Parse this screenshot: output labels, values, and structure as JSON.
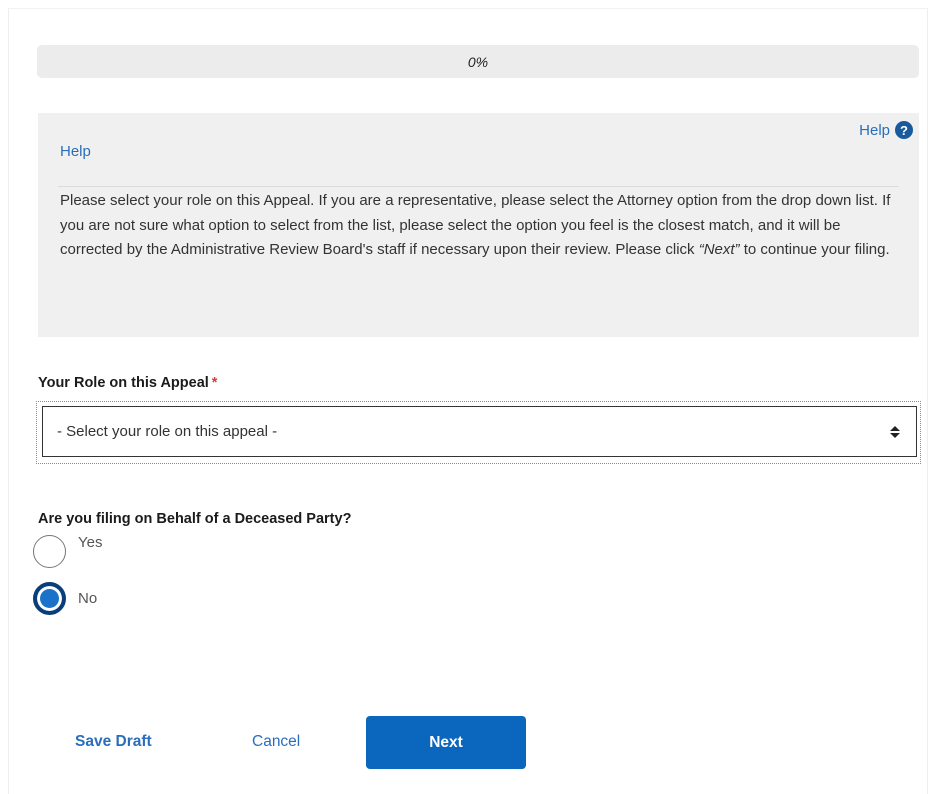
{
  "progress": {
    "label": "0%",
    "value": 0
  },
  "help": {
    "link_label": "Help",
    "title": "Help",
    "text_parts": [
      "Please select your role on this Appeal. If you are a representative, please select the Attorney option from the drop down list. If you are not sure what option to select from the list, please select the option you feel is the closest match, and it will be corrected by the Administrative Review Board's staff if necessary upon their review. Please click ",
      "“Next”",
      " to continue your filing."
    ]
  },
  "role_field": {
    "label": "Your Role on this Appeal",
    "required_marker": "*",
    "selected": "- Select your role on this appeal -"
  },
  "deceased_question": {
    "label": "Are you filing on Behalf of a Deceased Party?",
    "options": [
      {
        "label": "Yes",
        "checked": false
      },
      {
        "label": "No",
        "checked": true
      }
    ]
  },
  "actions": {
    "save_draft": "Save Draft",
    "cancel": "Cancel",
    "next": "Next"
  },
  "colors": {
    "link": "#2a6ebb",
    "primary_button": "#0b66bd",
    "required": "#d83933"
  }
}
